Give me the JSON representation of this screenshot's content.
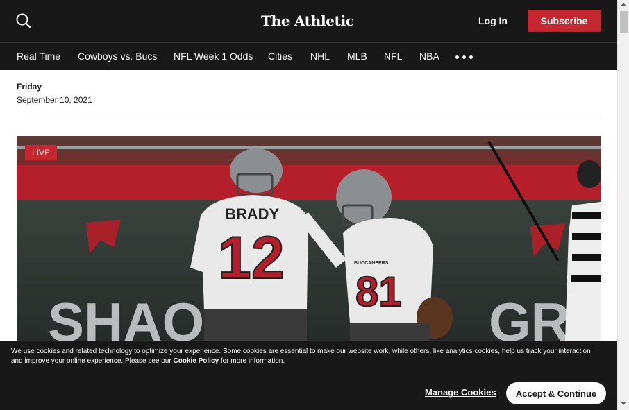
{
  "header": {
    "brand": "The Athletic",
    "search_icon": "search-icon",
    "login_label": "Log In",
    "subscribe_label": "Subscribe",
    "subscribe_color": "#c4272f"
  },
  "nav": {
    "items": [
      "Real Time",
      "Cowboys vs. Bucs",
      "NFL Week 1 Odds",
      "Cities",
      "NHL",
      "MLB",
      "NFL",
      "NBA"
    ],
    "more_icon": "more-dots-icon"
  },
  "date_block": {
    "day": "Friday",
    "date": "September 10, 2021"
  },
  "hero": {
    "badge": "LIVE",
    "jersey_left_name": "BRADY",
    "jersey_left_number": "12",
    "jersey_right_number": "81",
    "jersey_right_small": "BUCCANEERS",
    "sign_left": "SHAQ'S",
    "sign_right": "GROW"
  },
  "cookie_banner": {
    "text_before": "We use cookies and related technology to optimize your experience. Some cookies are essential to make our website work, while others, like analytics cookies, help us track your interaction and improve your online experience. Please see our ",
    "link": "Cookie Policy",
    "text_after": " for more information.",
    "manage_label": "Manage Cookies",
    "accept_label": "Accept & Continue"
  }
}
